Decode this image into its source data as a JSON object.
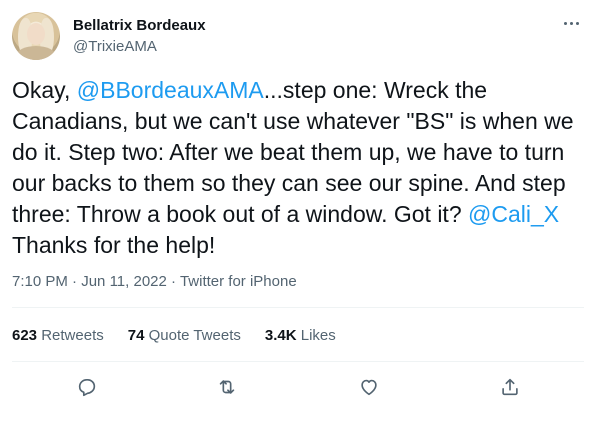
{
  "author": {
    "display_name": "Bellatrix Bordeaux",
    "handle": "@TrixieAMA"
  },
  "tweet": {
    "segments": [
      {
        "type": "text",
        "text": "Okay, "
      },
      {
        "type": "mention",
        "text": "@BBordeauxAMA"
      },
      {
        "type": "text",
        "text": "...step one: Wreck the Canadians, but we can't use whatever \"BS\" is when we do it. Step two: After we beat them up, we have to turn our backs to them so they can see our spine. And step three: Throw a book out of a window. Got it? "
      },
      {
        "type": "mention",
        "text": "@Cali_X"
      },
      {
        "type": "text",
        "text": " Thanks for the help!"
      }
    ],
    "time": "7:10 PM",
    "separator": "·",
    "date": "Jun 11, 2022",
    "source": "Twitter for iPhone"
  },
  "stats": {
    "retweets": {
      "count": "623",
      "label": "Retweets"
    },
    "quote_tweets": {
      "count": "74",
      "label": "Quote Tweets"
    },
    "likes": {
      "count": "3.4K",
      "label": "Likes"
    }
  },
  "icons": {
    "more": "more-horizontal-icon",
    "reply": "reply-icon",
    "retweet": "retweet-icon",
    "like": "heart-icon",
    "share": "share-icon"
  },
  "colors": {
    "mention": "#1d9bf0",
    "text": "#0f1419",
    "secondary": "#536471",
    "divider": "#eff3f4"
  }
}
